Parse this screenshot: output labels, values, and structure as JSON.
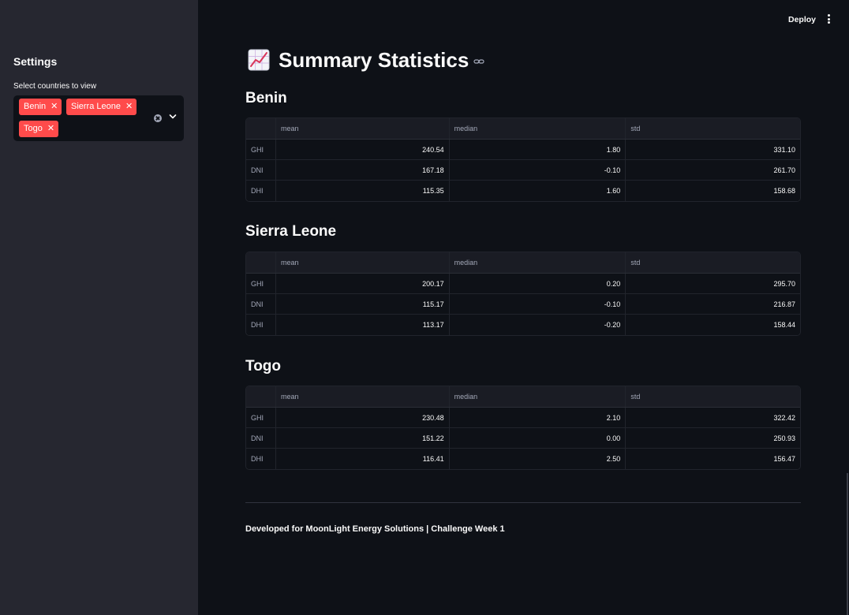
{
  "header": {
    "deploy_label": "Deploy",
    "menu_icon": "vertical-ellipsis-icon"
  },
  "sidebar": {
    "title": "Settings",
    "select_label": "Select countries to view",
    "selected": [
      {
        "label": "Benin"
      },
      {
        "label": "Sierra Leone"
      },
      {
        "label": "Togo"
      }
    ],
    "tag_color": "#ff4b4b"
  },
  "main": {
    "title": "Summary Statistics",
    "title_icon": "chart-increasing-emoji",
    "columns": [
      "",
      "mean",
      "median",
      "std"
    ],
    "sections": [
      {
        "title": "Benin",
        "rows": [
          {
            "label": "GHI",
            "mean": "240.54",
            "median": "1.80",
            "std": "331.10"
          },
          {
            "label": "DNI",
            "mean": "167.18",
            "median": "-0.10",
            "std": "261.70"
          },
          {
            "label": "DHI",
            "mean": "115.35",
            "median": "1.60",
            "std": "158.68"
          }
        ]
      },
      {
        "title": "Sierra Leone",
        "rows": [
          {
            "label": "GHI",
            "mean": "200.17",
            "median": "0.20",
            "std": "295.70"
          },
          {
            "label": "DNI",
            "mean": "115.17",
            "median": "-0.10",
            "std": "216.87"
          },
          {
            "label": "DHI",
            "mean": "113.17",
            "median": "-0.20",
            "std": "158.44"
          }
        ]
      },
      {
        "title": "Togo",
        "rows": [
          {
            "label": "GHI",
            "mean": "230.48",
            "median": "2.10",
            "std": "322.42"
          },
          {
            "label": "DNI",
            "mean": "151.22",
            "median": "0.00",
            "std": "250.93"
          },
          {
            "label": "DHI",
            "mean": "116.41",
            "median": "2.50",
            "std": "156.47"
          }
        ]
      }
    ],
    "footer": "Developed for MoonLight Energy Solutions | Challenge Week 1"
  },
  "colors": {
    "background": "#0e1117",
    "sidebar": "#262730",
    "accent": "#ff4b4b"
  }
}
